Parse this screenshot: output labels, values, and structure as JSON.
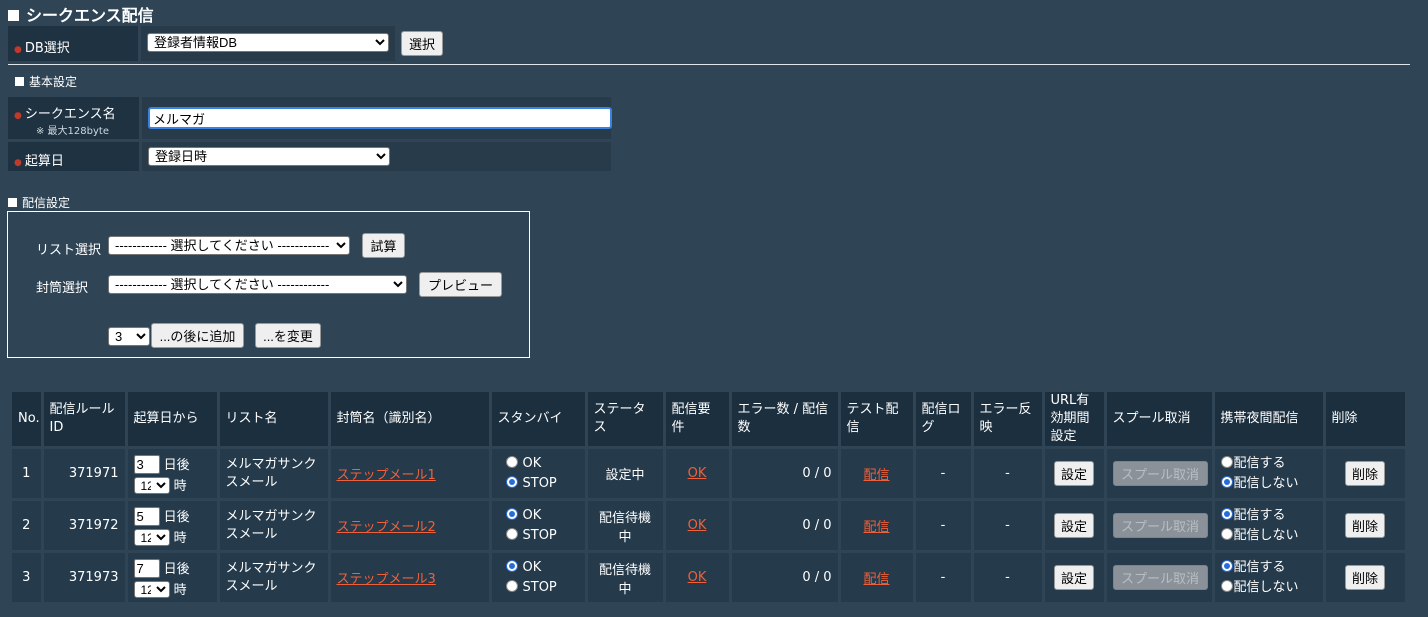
{
  "page_title": "シークエンス配信",
  "db": {
    "label": "DB選択",
    "selected": "登録者情報DB",
    "button": "選択"
  },
  "basic": {
    "heading": "基本設定",
    "seq_label": "シークエンス名",
    "seq_note": "※ 最大128byte",
    "seq_value": "メルマガ",
    "start_label": "起算日",
    "start_selected": "登録日時"
  },
  "delivery": {
    "heading": "配信設定",
    "list_label": "リスト選択",
    "list_selected": "------------ 選択してください ------------",
    "list_button": "試算",
    "env_label": "封筒選択",
    "env_selected": "------------ 選択してください ------------",
    "env_button": "プレビュー",
    "pos_selected": "3",
    "add_after_button": "...の後に追加",
    "change_button": "...を変更"
  },
  "table": {
    "headers": [
      "No.",
      "配信ルールID",
      "起算日から",
      "リスト名",
      "封筒名（識別名）",
      "スタンバイ",
      "ステータス",
      "配信要件",
      "エラー数 / 配信数",
      "テスト配信",
      "配信ログ",
      "エラー反映",
      "URL有効期間設定",
      "スプール取消",
      "携帯夜間配信",
      "削除"
    ],
    "day_suffix": "日後",
    "hour_suffix": "時",
    "ok_label": "OK",
    "stop_label": "STOP",
    "send_label": "配信する",
    "nosend_label": "配信しない",
    "setting_button": "設定",
    "spool_button": "スプール取消",
    "delete_button": "削除",
    "rows": [
      {
        "no": "1",
        "id": "371971",
        "days": "3",
        "hour": "12",
        "list": "メルマガサンクスメール",
        "envelope": "ステップメール1",
        "standby": "STOP",
        "status": "設定中",
        "req": "OK",
        "count": "0 / 0",
        "test": "配信",
        "log": "-",
        "err": "-",
        "night": "配信しない"
      },
      {
        "no": "2",
        "id": "371972",
        "days": "5",
        "hour": "12",
        "list": "メルマガサンクスメール",
        "envelope": "ステップメール2",
        "standby": "OK",
        "status": "配信待機中",
        "req": "OK",
        "count": "0 / 0",
        "test": "配信",
        "log": "-",
        "err": "-",
        "night": "配信する"
      },
      {
        "no": "3",
        "id": "371973",
        "days": "7",
        "hour": "12",
        "list": "メルマガサンクスメール",
        "envelope": "ステップメール3",
        "standby": "OK",
        "status": "配信待機中",
        "req": "OK",
        "count": "0 / 0",
        "test": "配信",
        "log": "-",
        "err": "-",
        "night": "配信する"
      }
    ]
  }
}
